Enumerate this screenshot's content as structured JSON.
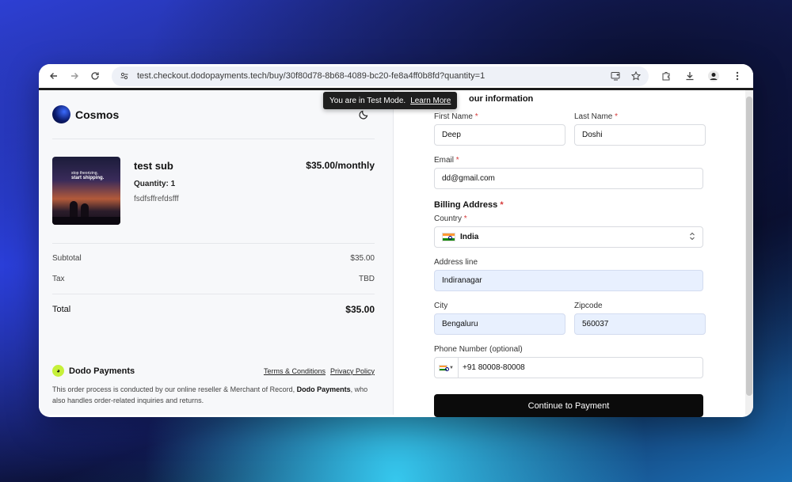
{
  "browser": {
    "url": "test.checkout.dodopayments.tech/buy/30f80d78-8b68-4089-bc20-fe8a4ff0b8fd?quantity=1"
  },
  "toast": {
    "message": "You are in Test Mode.",
    "link": "Learn More"
  },
  "store": {
    "name": "Cosmos"
  },
  "product": {
    "name": "test sub",
    "price": "$35.00/monthly",
    "quantity": "Quantity: 1",
    "description": "fsdfsffrefdsfff",
    "thumb_line1": "stop theorizing,",
    "thumb_line2": "start shipping."
  },
  "summary": {
    "subtotal_label": "Subtotal",
    "subtotal_value": "$35.00",
    "tax_label": "Tax",
    "tax_value": "TBD",
    "total_label": "Total",
    "total_value": "$35.00"
  },
  "footer": {
    "brand": "Dodo Payments",
    "terms": "Terms & Conditions",
    "privacy": "Privacy Policy",
    "note_pre": "This order process is conducted by our online reseller & Merchant of Record, ",
    "note_brand": "Dodo Payments",
    "note_post": ", who also handles order-related inquiries and returns."
  },
  "form": {
    "section_title": "our information",
    "first_name_label": "First Name",
    "first_name_value": "Deep",
    "last_name_label": "Last Name",
    "last_name_value": "Doshi",
    "email_label": "Email",
    "email_value": "dd@gmail.com",
    "billing_title": "Billing Address",
    "country_label": "Country",
    "country_value": "India",
    "address_label": "Address line",
    "address_value": "Indiranagar",
    "city_label": "City",
    "city_value": "Bengaluru",
    "zip_label": "Zipcode",
    "zip_value": "560037",
    "phone_label": "Phone Number (optional)",
    "phone_value": "+91 80008-80008",
    "required_mark": "*",
    "submit": "Continue to Payment"
  }
}
